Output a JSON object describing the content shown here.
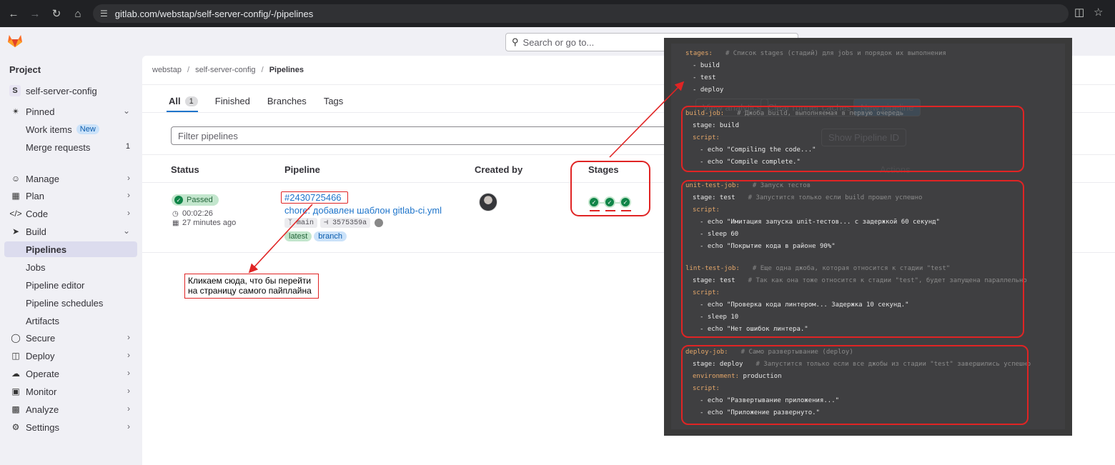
{
  "browser": {
    "url": "gitlab.com/webstap/self-server-config/-/pipelines"
  },
  "header": {
    "search_placeholder": "Search or go to..."
  },
  "sidebar": {
    "heading": "Project",
    "project_initial": "S",
    "project_name": "self-server-config",
    "pinned_label": "Pinned",
    "work_items_label": "Work items",
    "new_badge": "New",
    "merge_requests_label": "Merge requests",
    "merge_requests_count": "1",
    "items": [
      {
        "label": "Manage"
      },
      {
        "label": "Plan"
      },
      {
        "label": "Code"
      },
      {
        "label": "Build"
      },
      {
        "label": "Pipelines"
      },
      {
        "label": "Jobs"
      },
      {
        "label": "Pipeline editor"
      },
      {
        "label": "Pipeline schedules"
      },
      {
        "label": "Artifacts"
      },
      {
        "label": "Secure"
      },
      {
        "label": "Deploy"
      },
      {
        "label": "Operate"
      },
      {
        "label": "Monitor"
      },
      {
        "label": "Analyze"
      },
      {
        "label": "Settings"
      }
    ]
  },
  "breadcrumb": {
    "group": "webstap",
    "project": "self-server-config",
    "current": "Pipelines",
    "sep": "/"
  },
  "tabs": {
    "all": "All",
    "all_count": "1",
    "finished": "Finished",
    "branches": "Branches",
    "tags": "Tags"
  },
  "filter": {
    "placeholder": "Filter pipelines"
  },
  "table": {
    "headers": {
      "status": "Status",
      "pipeline": "Pipeline",
      "created_by": "Created by",
      "stages": "Stages",
      "actions": "Actions"
    },
    "row": {
      "status": "Passed",
      "duration": "00:02:26",
      "finished": "27 minutes ago",
      "pipeline_id": "#2430725466",
      "commit_title": "chore: добавлен шаблон gitlab-ci.yml",
      "branch": "main",
      "commit_sha": "3575359a",
      "badges": [
        "latest",
        "branch"
      ]
    }
  },
  "annotation": {
    "callout": "Кликаем сюда, что бы перейти на страницу самого пайплайна"
  },
  "ghost": {
    "view_analytics": "View analytics",
    "clear_caches": "Clear runner caches",
    "new_pipeline": "New pipeline",
    "show_pipeline_id": "Show Pipeline ID"
  },
  "code": {
    "lines": [
      {
        "k": "stages:",
        "c": "# Список stages (стадий) для jobs и порядок их выполнения",
        "pad": 0
      },
      {
        "t": "- build",
        "pad": 10
      },
      {
        "t": "- test",
        "pad": 10
      },
      {
        "t": "- deploy",
        "pad": 10
      },
      {
        "k": "build-job:",
        "c": "# Джоба build, выполняемая в первую очередь",
        "pad": 0
      },
      {
        "t": "stage: build",
        "pad": 10
      },
      {
        "k": "script:",
        "pad": 10
      },
      {
        "t": "- echo \"Compiling the code...\"",
        "pad": 20
      },
      {
        "t": "- echo \"Compile complete.\"",
        "pad": 20
      },
      {
        "k": "unit-test-job:",
        "c": "# Запуск тестов",
        "pad": 0
      },
      {
        "t": "stage: test",
        "c": "# Запустится только если build прошел успешно",
        "pad": 10
      },
      {
        "k": "script:",
        "pad": 10
      },
      {
        "t": "- echo \"Имитация запуска unit-тестов... с задержкой 60 секунд\"",
        "pad": 20
      },
      {
        "t": "- sleep 60",
        "pad": 20
      },
      {
        "t": "- echo \"Покрытие кода в районе 90%\"",
        "pad": 20
      },
      {
        "k": "lint-test-job:",
        "c": "# Еще одна джоба, которая относится к стадии \"test\"",
        "pad": 0
      },
      {
        "t": "stage: test",
        "c": "# Так как она тоже относится к стадии \"test\", будет запущена параллельно",
        "pad": 10
      },
      {
        "k": "script:",
        "pad": 10
      },
      {
        "t": "- echo \"Проверка кода линтером... Задержка 10 секунд.\"",
        "pad": 20
      },
      {
        "t": "- sleep 10",
        "pad": 20
      },
      {
        "t": "- echo \"Нет ошибок линтера.\"",
        "pad": 20
      },
      {
        "k": "deploy-job:",
        "c": "# Само развертывание (deploy)",
        "pad": 0
      },
      {
        "t": "stage: deploy",
        "c": "# Запустится только если все джобы из стадии \"test\" завершились успешно",
        "pad": 10
      },
      {
        "k": "environment:",
        "t": " production",
        "pad": 10
      },
      {
        "k": "script:",
        "pad": 10
      },
      {
        "t": "- echo \"Развертывание приложения...\"",
        "pad": 20
      },
      {
        "t": "- echo \"Приложение развернуто.\"",
        "pad": 20
      }
    ]
  }
}
